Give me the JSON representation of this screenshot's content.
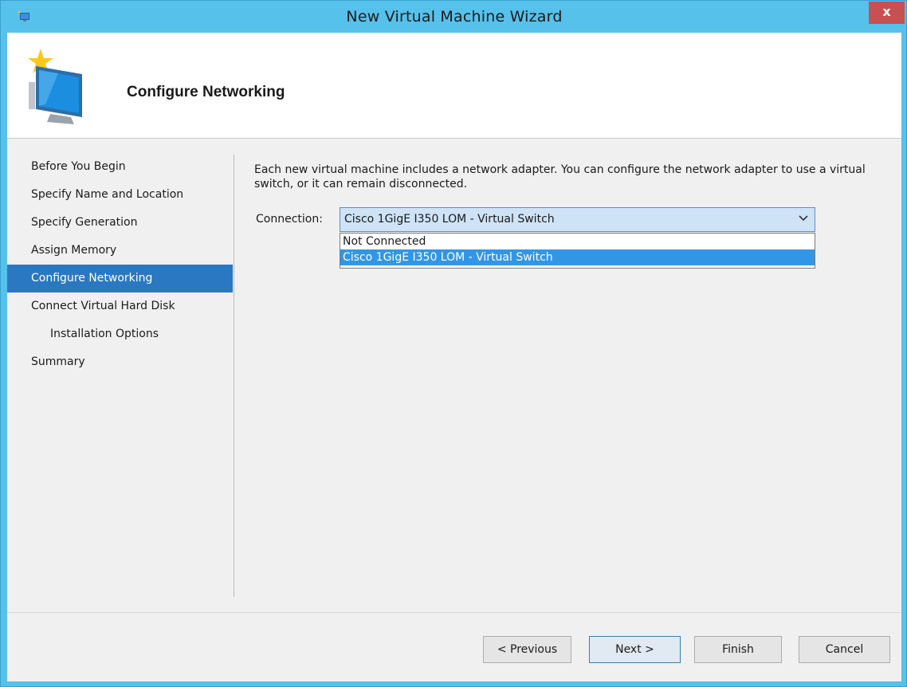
{
  "window": {
    "title": "New Virtual Machine Wizard",
    "close_label": "x"
  },
  "header": {
    "title": "Configure Networking"
  },
  "nav": {
    "items": [
      {
        "label": "Before You Begin"
      },
      {
        "label": "Specify Name and Location"
      },
      {
        "label": "Specify Generation"
      },
      {
        "label": "Assign Memory"
      },
      {
        "label": "Configure Networking",
        "active": true
      },
      {
        "label": "Connect Virtual Hard Disk"
      },
      {
        "label": "Installation Options",
        "sub": true
      },
      {
        "label": "Summary"
      }
    ]
  },
  "main": {
    "description": "Each new virtual machine includes a network adapter. You can configure the network adapter to use a virtual switch, or it can remain disconnected.",
    "connection_label": "Connection:",
    "connection_value": "Cisco 1GigE I350 LOM - Virtual Switch",
    "options": [
      {
        "label": "Not Connected"
      },
      {
        "label": "Cisco 1GigE I350 LOM - Virtual Switch",
        "selected": true
      }
    ]
  },
  "buttons": {
    "previous": "< Previous",
    "next": "Next >",
    "finish": "Finish",
    "cancel": "Cancel"
  },
  "colors": {
    "window_frame": "#56c1eb",
    "close_button": "#c75050",
    "nav_active": "#2a78c2",
    "option_selected": "#3296e6"
  },
  "icons": {
    "app": "hyperv-app-icon",
    "header": "virtual-machine-wizard-icon",
    "dropdown": "chevron-down-icon"
  }
}
